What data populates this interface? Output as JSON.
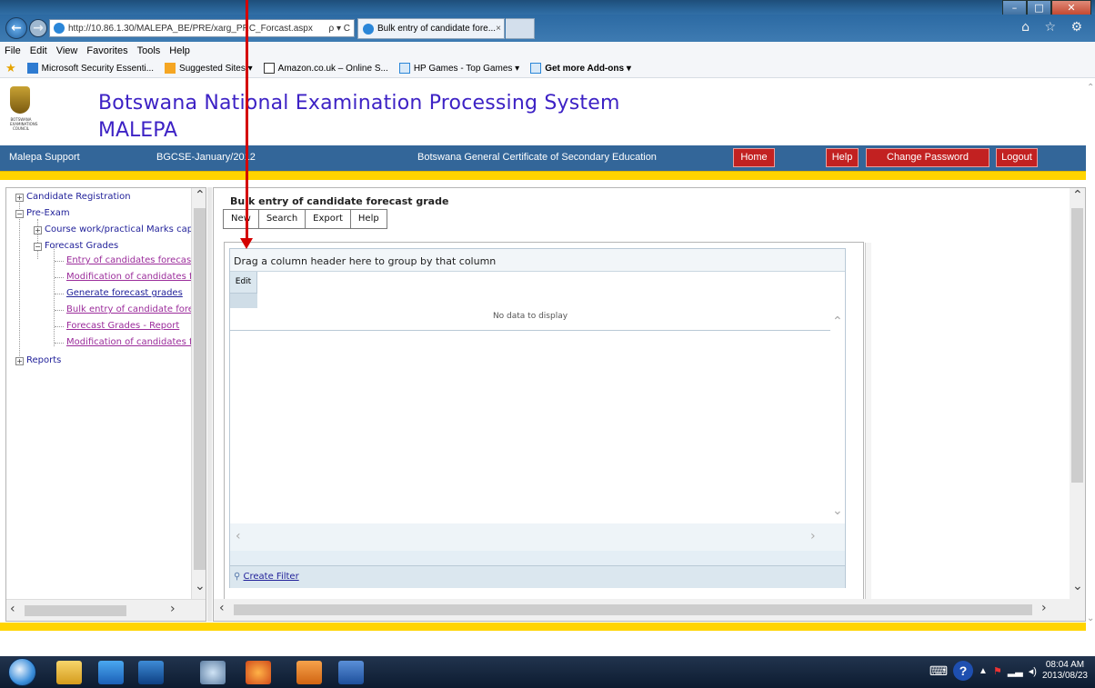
{
  "browser": {
    "address": "http://10.86.1.30/MALEPA_BE/PRE/xarg_PRC_Forcast.aspx",
    "address_tail": "ρ ▾ C",
    "tab_title": "Bulk entry of candidate fore...",
    "tab_close": "×",
    "menu": [
      "File",
      "Edit",
      "View",
      "Favorites",
      "Tools",
      "Help"
    ],
    "favorites": [
      {
        "label": "Microsoft Security Essenti...",
        "color": "#2e7bd1"
      },
      {
        "label": "Suggested Sites ▾",
        "color": "#f5a623"
      },
      {
        "label": "Amazon.co.uk – Online S...",
        "color": "#333333"
      },
      {
        "label": "HP Games - Top Games ▾",
        "color": "#2a86d8"
      },
      {
        "label": "Get more Add-ons ▾",
        "color": "#2a86d8",
        "bold": true
      }
    ],
    "right_icons": "⌂ ☆ ⚙",
    "window_buttons": {
      "minimize": "–",
      "maximize": "□",
      "close": "✕"
    }
  },
  "header": {
    "title": "Botswana National Examination Processing System",
    "subtitle": "MALEPA",
    "logo_caption": "BOTSWANA EXAMINATIONS COUNCIL"
  },
  "bluebar": {
    "user": "Malepa Support",
    "session": "BGCSE-January/2012",
    "qualification": "Botswana General Certificate of Secondary Education",
    "buttons": {
      "home": "Home",
      "help": "Help",
      "change_password": "Change Password",
      "logout": "Logout"
    }
  },
  "tree": {
    "items": [
      {
        "label": "Candidate Registration",
        "toggle": "+"
      },
      {
        "label": "Pre-Exam",
        "toggle": "−"
      },
      {
        "label": "Course work/practical Marks capt",
        "toggle": "+"
      },
      {
        "label": "Forecast Grades",
        "toggle": "−"
      },
      {
        "label": "Entry of candidates forecast"
      },
      {
        "label": "Modification of candidates fo"
      },
      {
        "label": "Generate forecast grades"
      },
      {
        "label": "Bulk entry of candidate forec"
      },
      {
        "label": "Forecast Grades - Report"
      },
      {
        "label": "Modification of candidates fo"
      },
      {
        "label": "Reports",
        "toggle": "+"
      }
    ]
  },
  "main": {
    "title": "Bulk entry of candidate forecast grade",
    "toolbar": {
      "new": "New",
      "search": "Search",
      "export": "Export",
      "help": "Help"
    },
    "grid": {
      "group_hint": "Drag a column header here to group by that column",
      "edit_column": "Edit",
      "empty_text": "No data to display",
      "create_filter": "Create Filter"
    }
  },
  "taskbar": {
    "time": "08:04 AM",
    "date": "2013/08/23",
    "help_icon": "?"
  }
}
